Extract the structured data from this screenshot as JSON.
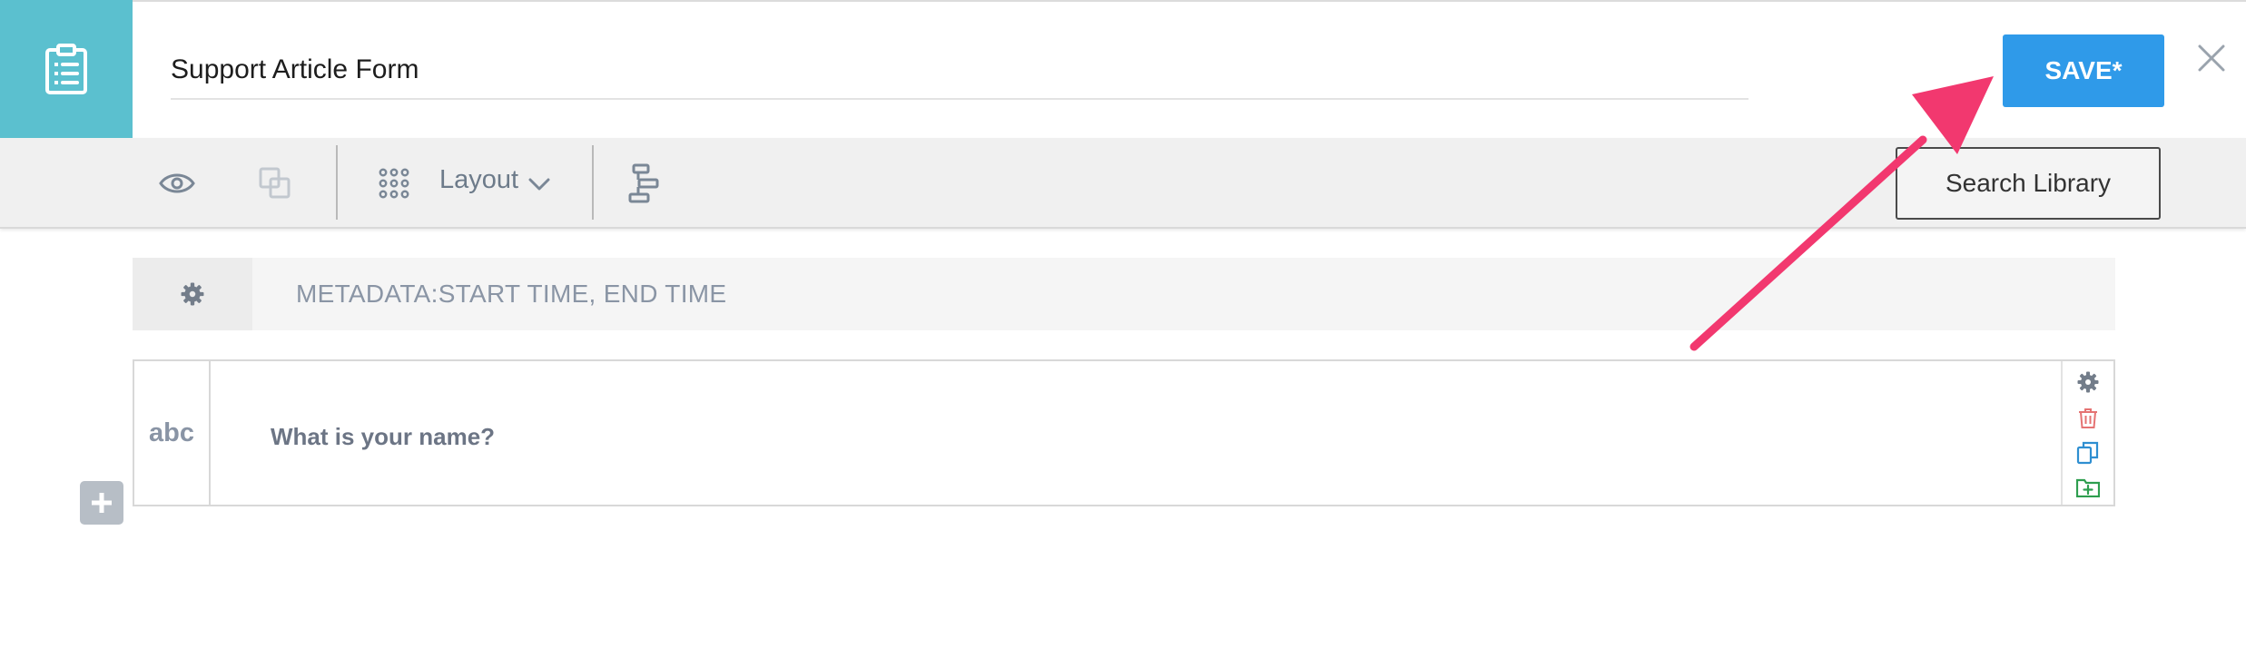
{
  "header": {
    "form_title": "Support Article Form",
    "save_label": "SAVE*"
  },
  "toolbar": {
    "layout_label": "Layout",
    "search_library_label": "Search Library"
  },
  "metadata": {
    "text": "METADATA:START TIME, END TIME"
  },
  "question": {
    "type_label": "abc",
    "text": "What is your name?"
  },
  "icons": {
    "form": "clipboard-list-icon",
    "close": "close-icon",
    "preview": "eye-icon",
    "duplicate": "copy-icon",
    "layout": "grid-icon",
    "layout_dropdown": "chevron-down-icon",
    "logic": "branch-icon",
    "settings": "gear-icon",
    "delete": "trash-icon",
    "copy": "copy-icon",
    "add_to_library": "folder-plus-icon",
    "add_question": "plus-icon"
  },
  "colors": {
    "accent_teal": "#5bc0cf",
    "save_blue": "#2f9ae9",
    "annotation_pink": "#f2386f",
    "delete_red": "#e57373",
    "copy_blue": "#2f8fd1",
    "library_green": "#2e9e4f"
  }
}
